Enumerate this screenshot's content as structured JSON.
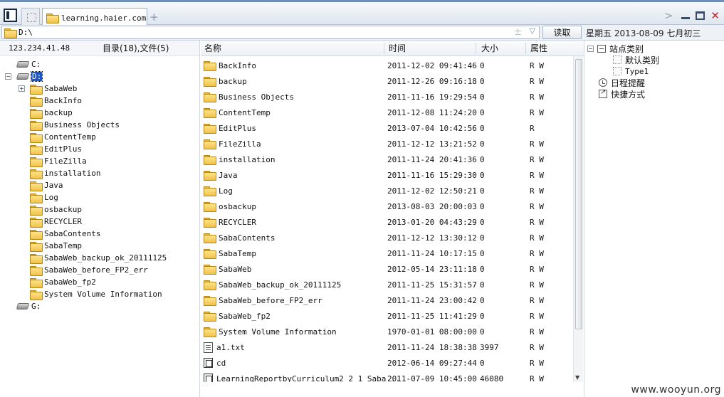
{
  "tab": {
    "title": "learning.haier.com"
  },
  "address": {
    "value": "D:\\",
    "read_button": "读取"
  },
  "date_line": "星期五 2013-08-09 七月初三",
  "left": {
    "ip": "123.234.41.48",
    "summary": "目录(18),文件(5)",
    "drives": [
      "C:",
      "D:",
      "G:"
    ],
    "folders": [
      "SabaWeb",
      "BackInfo",
      "backup",
      "Business Objects",
      "ContentTemp",
      "EditPlus",
      "FileZilla",
      "installation",
      "Java",
      "Log",
      "osbackup",
      "RECYCLER",
      "SabaContents",
      "SabaTemp",
      "SabaWeb_backup_ok_20111125",
      "SabaWeb_before_FP2_err",
      "SabaWeb_fp2",
      "System Volume Information"
    ]
  },
  "columns": {
    "name": "名称",
    "time": "时间",
    "size": "大小",
    "attr": "属性"
  },
  "files": [
    {
      "name": "BackInfo",
      "time": "2011-12-02 09:41:46",
      "size": "0",
      "attr": "R W",
      "type": "folder"
    },
    {
      "name": "backup",
      "time": "2011-12-26 09:16:18",
      "size": "0",
      "attr": "R W",
      "type": "folder"
    },
    {
      "name": "Business Objects",
      "time": "2011-11-16 19:29:54",
      "size": "0",
      "attr": "R W",
      "type": "folder"
    },
    {
      "name": "ContentTemp",
      "time": "2011-12-08 11:24:20",
      "size": "0",
      "attr": "R W",
      "type": "folder"
    },
    {
      "name": "EditPlus",
      "time": "2013-07-04 10:42:56",
      "size": "0",
      "attr": "R",
      "type": "folder"
    },
    {
      "name": "FileZilla",
      "time": "2011-12-12 13:21:52",
      "size": "0",
      "attr": "R W",
      "type": "folder"
    },
    {
      "name": "installation",
      "time": "2011-11-24 20:41:36",
      "size": "0",
      "attr": "R W",
      "type": "folder"
    },
    {
      "name": "Java",
      "time": "2011-11-16 15:29:30",
      "size": "0",
      "attr": "R W",
      "type": "folder"
    },
    {
      "name": "Log",
      "time": "2011-12-02 12:50:21",
      "size": "0",
      "attr": "R W",
      "type": "folder"
    },
    {
      "name": "osbackup",
      "time": "2013-08-03 20:00:03",
      "size": "0",
      "attr": "R W",
      "type": "folder"
    },
    {
      "name": "RECYCLER",
      "time": "2013-01-20 04:43:29",
      "size": "0",
      "attr": "R W",
      "type": "folder"
    },
    {
      "name": "SabaContents",
      "time": "2011-12-12 13:30:12",
      "size": "0",
      "attr": "R W",
      "type": "folder"
    },
    {
      "name": "SabaTemp",
      "time": "2011-11-24 10:17:15",
      "size": "0",
      "attr": "R W",
      "type": "folder"
    },
    {
      "name": "SabaWeb",
      "time": "2012-05-14 23:11:18",
      "size": "0",
      "attr": "R W",
      "type": "folder"
    },
    {
      "name": "SabaWeb_backup_ok_20111125",
      "time": "2011-11-25 15:31:57",
      "size": "0",
      "attr": "R W",
      "type": "folder"
    },
    {
      "name": "SabaWeb_before_FP2_err",
      "time": "2011-11-24 23:00:42",
      "size": "0",
      "attr": "R W",
      "type": "folder"
    },
    {
      "name": "SabaWeb_fp2",
      "time": "2011-11-25 11:41:29",
      "size": "0",
      "attr": "R W",
      "type": "folder"
    },
    {
      "name": "System Volume Information",
      "time": "1970-01-01 08:00:00",
      "size": "0",
      "attr": "R W",
      "type": "folder"
    },
    {
      "name": "a1.txt",
      "time": "2011-11-24 18:38:38",
      "size": "3997",
      "attr": "R W",
      "type": "txt"
    },
    {
      "name": "cd",
      "time": "2012-06-14 09:27:44",
      "size": "0",
      "attr": "R W",
      "type": "exe"
    },
    {
      "name": "LearningReportbyCurriculum2_2_1_Saba...",
      "time": "2011-07-09 10:45:00",
      "size": "46080",
      "attr": "R W",
      "type": "exe"
    }
  ],
  "right": {
    "site_types": "站点类别",
    "default_type": "默认类别",
    "type1": "Type1",
    "reminder": "日程提醒",
    "shortcut": "快捷方式"
  },
  "watermark": "www.wooyun.org"
}
